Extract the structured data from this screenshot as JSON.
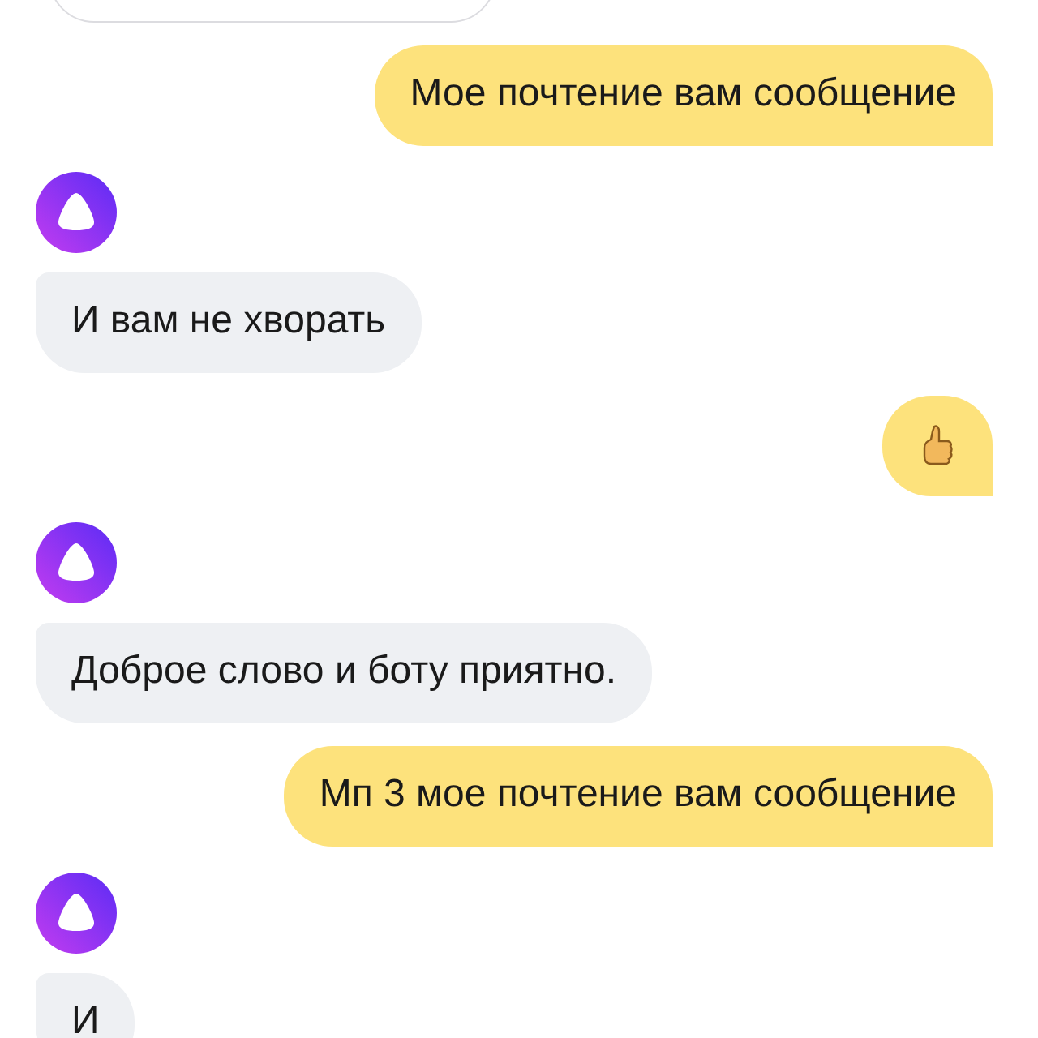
{
  "messages": [
    {
      "kind": "bot_card"
    },
    {
      "kind": "user_text",
      "text": "Мое почтение вам сообщение"
    },
    {
      "kind": "bot_text",
      "text": "И вам не хворать"
    },
    {
      "kind": "user_emoji"
    },
    {
      "kind": "bot_text",
      "text": "Доброе слово и боту приятно."
    },
    {
      "kind": "user_text",
      "text": "Мп 3 мое почтение вам сообщение"
    },
    {
      "kind": "bot_text",
      "text": "И"
    }
  ]
}
